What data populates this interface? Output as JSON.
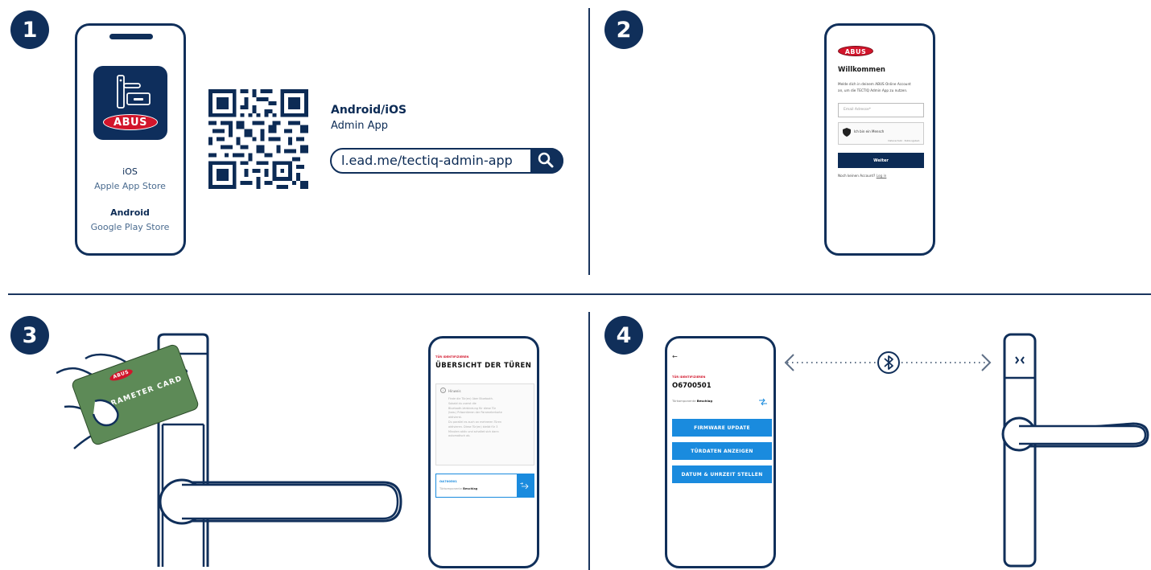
{
  "steps": [
    "1",
    "2",
    "3",
    "4"
  ],
  "step1": {
    "app_logo": "ABUS",
    "ios_label": "iOS",
    "ios_store": "Apple App Store",
    "android_label": "Android",
    "android_store": "Google Play Store",
    "platform_title": "Android/iOS",
    "platform_subtitle": "Admin App",
    "link_url": "l.ead.me/tectiq-admin-app"
  },
  "step2": {
    "logo": "ABUS",
    "welcome": "Willkommen",
    "intro_line1": "Melde dich in deinem ABUS Online Account",
    "intro_line2": "an, um die TECTIQ Admin App zu nutzen.",
    "email_placeholder": "Email Adresse*",
    "captcha_label": "Ich bin ein Mensch",
    "captcha_footer": "Datenschutz · Nutzungsbed.",
    "continue_button": "Weiter",
    "no_account": "Noch keinen Account?",
    "signup_link": "Log in"
  },
  "step3": {
    "card_logo": "ABUS",
    "card_text": "PARAMETER CARD",
    "phone_kicker": "TÜR IDENTIFIZIEREN",
    "phone_title": "ÜBERSICHT DER TÜREN",
    "notice_title": "Hinweis",
    "notice_lines": [
      "Finde die Tür(en) über Bluetooth.",
      "Sobald du zuerst die",
      "Bluetooth-Verbindung für diese Tür",
      "(bzw.) Präsentieren der Parameterkarte",
      "aktivierst.",
      "Du parallel es auch an mehreren Türen",
      "aktivieren. Diese Tür(en) bleibt für 3",
      "Minuten aktiv und schaltet sich dann",
      "automatisch ab."
    ],
    "door_id": "OA700501",
    "door_component_label": "Türkomponente",
    "door_component_value": "Beschlag"
  },
  "step4": {
    "back_arrow": "←",
    "kicker": "TÜR IDENTIFIZIEREN",
    "door_id": "O6700501",
    "component_label": "Türkomponente",
    "component_value": "Beschlag",
    "buttons": [
      "FIRMWARE UPDATE",
      "TÜRDATEN ANZEIGEN",
      "DATUM & UHRZEIT STELLEN"
    ]
  },
  "colors": {
    "navy": "#102f5a",
    "abus_red": "#d2152b",
    "app_blue": "#1a8bde",
    "card_green": "#5d8a57"
  }
}
